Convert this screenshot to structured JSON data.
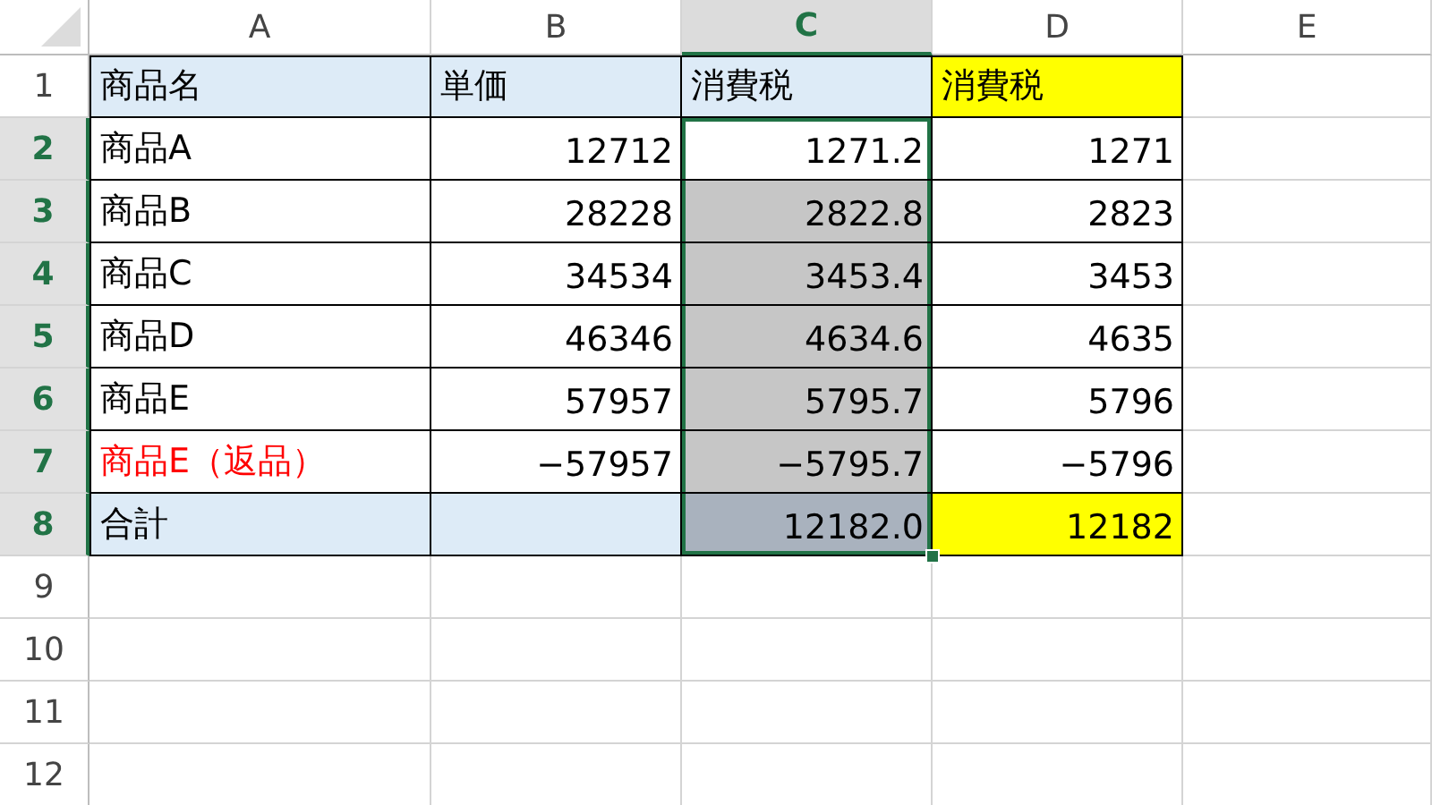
{
  "columns": [
    {
      "label": "A",
      "selected": false
    },
    {
      "label": "B",
      "selected": false
    },
    {
      "label": "C",
      "selected": true
    },
    {
      "label": "D",
      "selected": false
    },
    {
      "label": "E",
      "selected": false
    }
  ],
  "rows": [
    {
      "number": "1",
      "selected": false,
      "cells": [
        {
          "kind": "label",
          "text": "商品名",
          "color": "#ddebf7",
          "selected": false
        },
        {
          "kind": "label",
          "text": "単価",
          "color": "#ddebf7",
          "selected": false
        },
        {
          "kind": "label",
          "text": "消費税",
          "color": "#ddebf7",
          "selected": false
        },
        {
          "kind": "label",
          "text": "消費税",
          "color": "#ffff00",
          "selected": false
        }
      ]
    },
    {
      "number": "2",
      "selected": true,
      "cells": [
        {
          "kind": "label",
          "text": "商品A",
          "selected": false
        },
        {
          "kind": "number",
          "text": "12712",
          "selected": false
        },
        {
          "kind": "number",
          "text": "1271.2",
          "selected": true
        },
        {
          "kind": "number",
          "text": "1271",
          "selected": false
        }
      ]
    },
    {
      "number": "3",
      "selected": true,
      "cells": [
        {
          "kind": "label",
          "text": "商品B",
          "selected": false
        },
        {
          "kind": "number",
          "text": "28228",
          "selected": false
        },
        {
          "kind": "number",
          "text": "2822.8",
          "selected": true
        },
        {
          "kind": "number",
          "text": "2823",
          "selected": false
        }
      ]
    },
    {
      "number": "4",
      "selected": true,
      "cells": [
        {
          "kind": "label",
          "text": "商品C",
          "selected": false
        },
        {
          "kind": "number",
          "text": "34534",
          "selected": false
        },
        {
          "kind": "number",
          "text": "3453.4",
          "selected": true
        },
        {
          "kind": "number",
          "text": "3453",
          "selected": false
        }
      ]
    },
    {
      "number": "5",
      "selected": true,
      "cells": [
        {
          "kind": "label",
          "text": "商品D",
          "selected": false
        },
        {
          "kind": "number",
          "text": "46346",
          "selected": false
        },
        {
          "kind": "number",
          "text": "4634.6",
          "selected": true
        },
        {
          "kind": "number",
          "text": "4635",
          "selected": false
        }
      ]
    },
    {
      "number": "6",
      "selected": true,
      "cells": [
        {
          "kind": "label",
          "text": "商品E",
          "selected": false
        },
        {
          "kind": "number",
          "text": "57957",
          "selected": false
        },
        {
          "kind": "number",
          "text": "5795.7",
          "selected": true
        },
        {
          "kind": "number",
          "text": "5796",
          "selected": false
        }
      ]
    },
    {
      "number": "7",
      "selected": true,
      "cells": [
        {
          "kind": "alert_label",
          "text": "商品E（返品）",
          "selected": false
        },
        {
          "kind": "number",
          "text": "−57957",
          "selected": false
        },
        {
          "kind": "number",
          "text": "−5795.7",
          "selected": true
        },
        {
          "kind": "number",
          "text": "−5796",
          "selected": false
        }
      ]
    },
    {
      "number": "8",
      "selected": true,
      "cells": [
        {
          "kind": "label",
          "text": "合計",
          "color": "#ddebf7",
          "selected": false
        },
        {
          "kind": "label",
          "color": "#ddebf7",
          "selected": false
        },
        {
          "kind": "number",
          "text": "12182.0",
          "color": "#a9b2be",
          "selected": true
        },
        {
          "kind": "number",
          "text": "12182",
          "color": "#ffff00",
          "selected": false
        }
      ]
    },
    {
      "number": "9",
      "selected": false
    },
    {
      "number": "10",
      "selected": false
    },
    {
      "number": "11",
      "selected": false
    },
    {
      "number": "12",
      "selected": false
    }
  ]
}
